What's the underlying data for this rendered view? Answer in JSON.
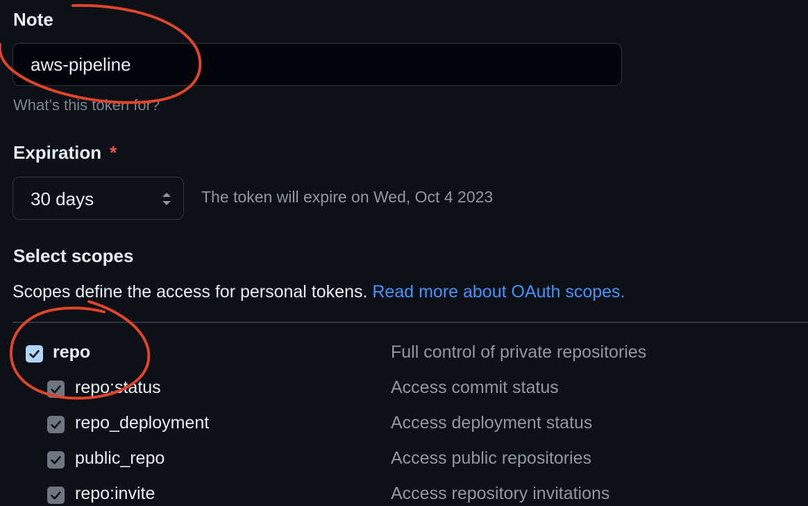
{
  "note": {
    "label": "Note",
    "value": "aws-pipeline",
    "hint": "What’s this token for?"
  },
  "expiration": {
    "label": "Expiration",
    "required_mark": "*",
    "selected": "30 days",
    "expire_text": "The token will expire on Wed, Oct 4 2023"
  },
  "scopes": {
    "label": "Select scopes",
    "description": "Scopes define the access for personal tokens.",
    "link_text": "Read more about OAuth scopes.",
    "items": [
      {
        "name": "repo",
        "description": "Full control of private repositories",
        "checked": true
      },
      {
        "name": "repo:status",
        "description": "Access commit status",
        "checked": true
      },
      {
        "name": "repo_deployment",
        "description": "Access deployment status",
        "checked": true
      },
      {
        "name": "public_repo",
        "description": "Access public repositories",
        "checked": true
      },
      {
        "name": "repo:invite",
        "description": "Access repository invitations",
        "checked": true
      }
    ]
  },
  "colors": {
    "background": "#0d1117",
    "link": "#4493f8",
    "required": "#f85149",
    "annotation": "#e0452b"
  }
}
